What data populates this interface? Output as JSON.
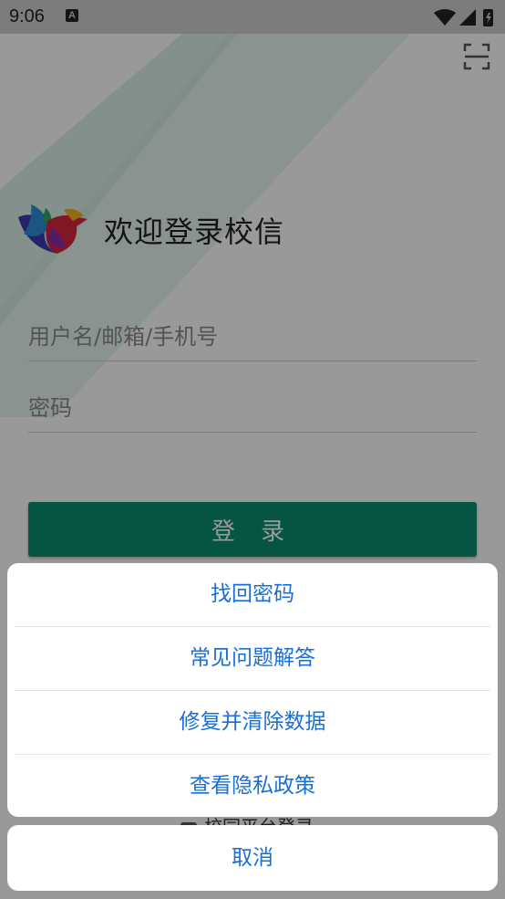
{
  "status_bar": {
    "time": "9:06",
    "notification_badge": "A",
    "icons": [
      "wifi-icon",
      "signal-icon",
      "battery-icon"
    ]
  },
  "header": {
    "scan_icon": "scan-icon"
  },
  "login": {
    "title": "欢迎登录校信",
    "username_placeholder": "用户名/邮箱/手机号",
    "password_placeholder": "密码",
    "login_button": "登 录",
    "other_login_partial": "校园平台登录"
  },
  "action_sheet": {
    "items": [
      "找回密码",
      "常见问题解答",
      "修复并清除数据",
      "查看隐私政策"
    ],
    "cancel": "取消"
  },
  "colors": {
    "accent_green": "#0a8e6e",
    "action_blue": "#1a6fd6"
  }
}
